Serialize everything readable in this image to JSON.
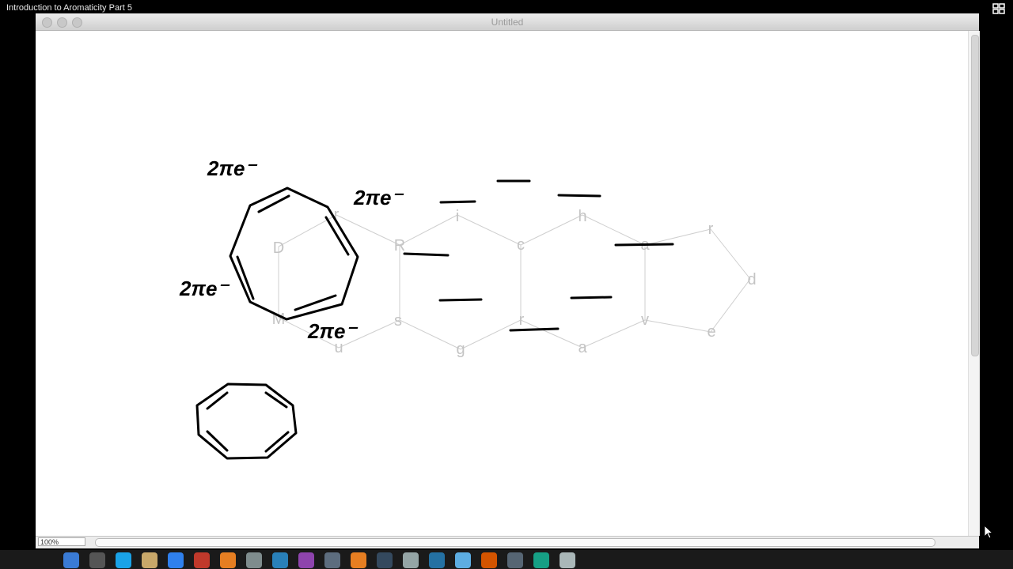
{
  "video": {
    "title": "Introduction to Aromaticity Part 5"
  },
  "window": {
    "title": "Untitled"
  },
  "statusbar": {
    "zoom": "100%"
  },
  "drawing": {
    "annotations": [
      "2πe⁻",
      "2πe⁻",
      "2πe⁻",
      "2πe⁻"
    ],
    "ghost_letters": [
      "D",
      "r",
      "R",
      "i",
      "c",
      "h",
      "a",
      "r",
      "d",
      "M",
      "u",
      "s",
      "g",
      "r",
      "a",
      "v",
      "e"
    ]
  },
  "dock": {
    "icons": [
      "finder-icon",
      "settings-icon",
      "skype-icon",
      "notes-icon",
      "safari-icon",
      "calendar-icon",
      "firefox-icon",
      "preview-icon",
      "itunes-icon",
      "photobooth-icon",
      "mail-icon",
      "vlc-icon",
      "dictionary-icon",
      "screenshot-icon",
      "quicktime-icon",
      "folder-icon",
      "slideshow-icon",
      "dvd-icon",
      "photo-icon",
      "trash-icon"
    ]
  },
  "colors": {
    "ink": "#000000",
    "ghost": "#c8c8c8",
    "page": "#ffffff",
    "chrome": "#ececec"
  }
}
